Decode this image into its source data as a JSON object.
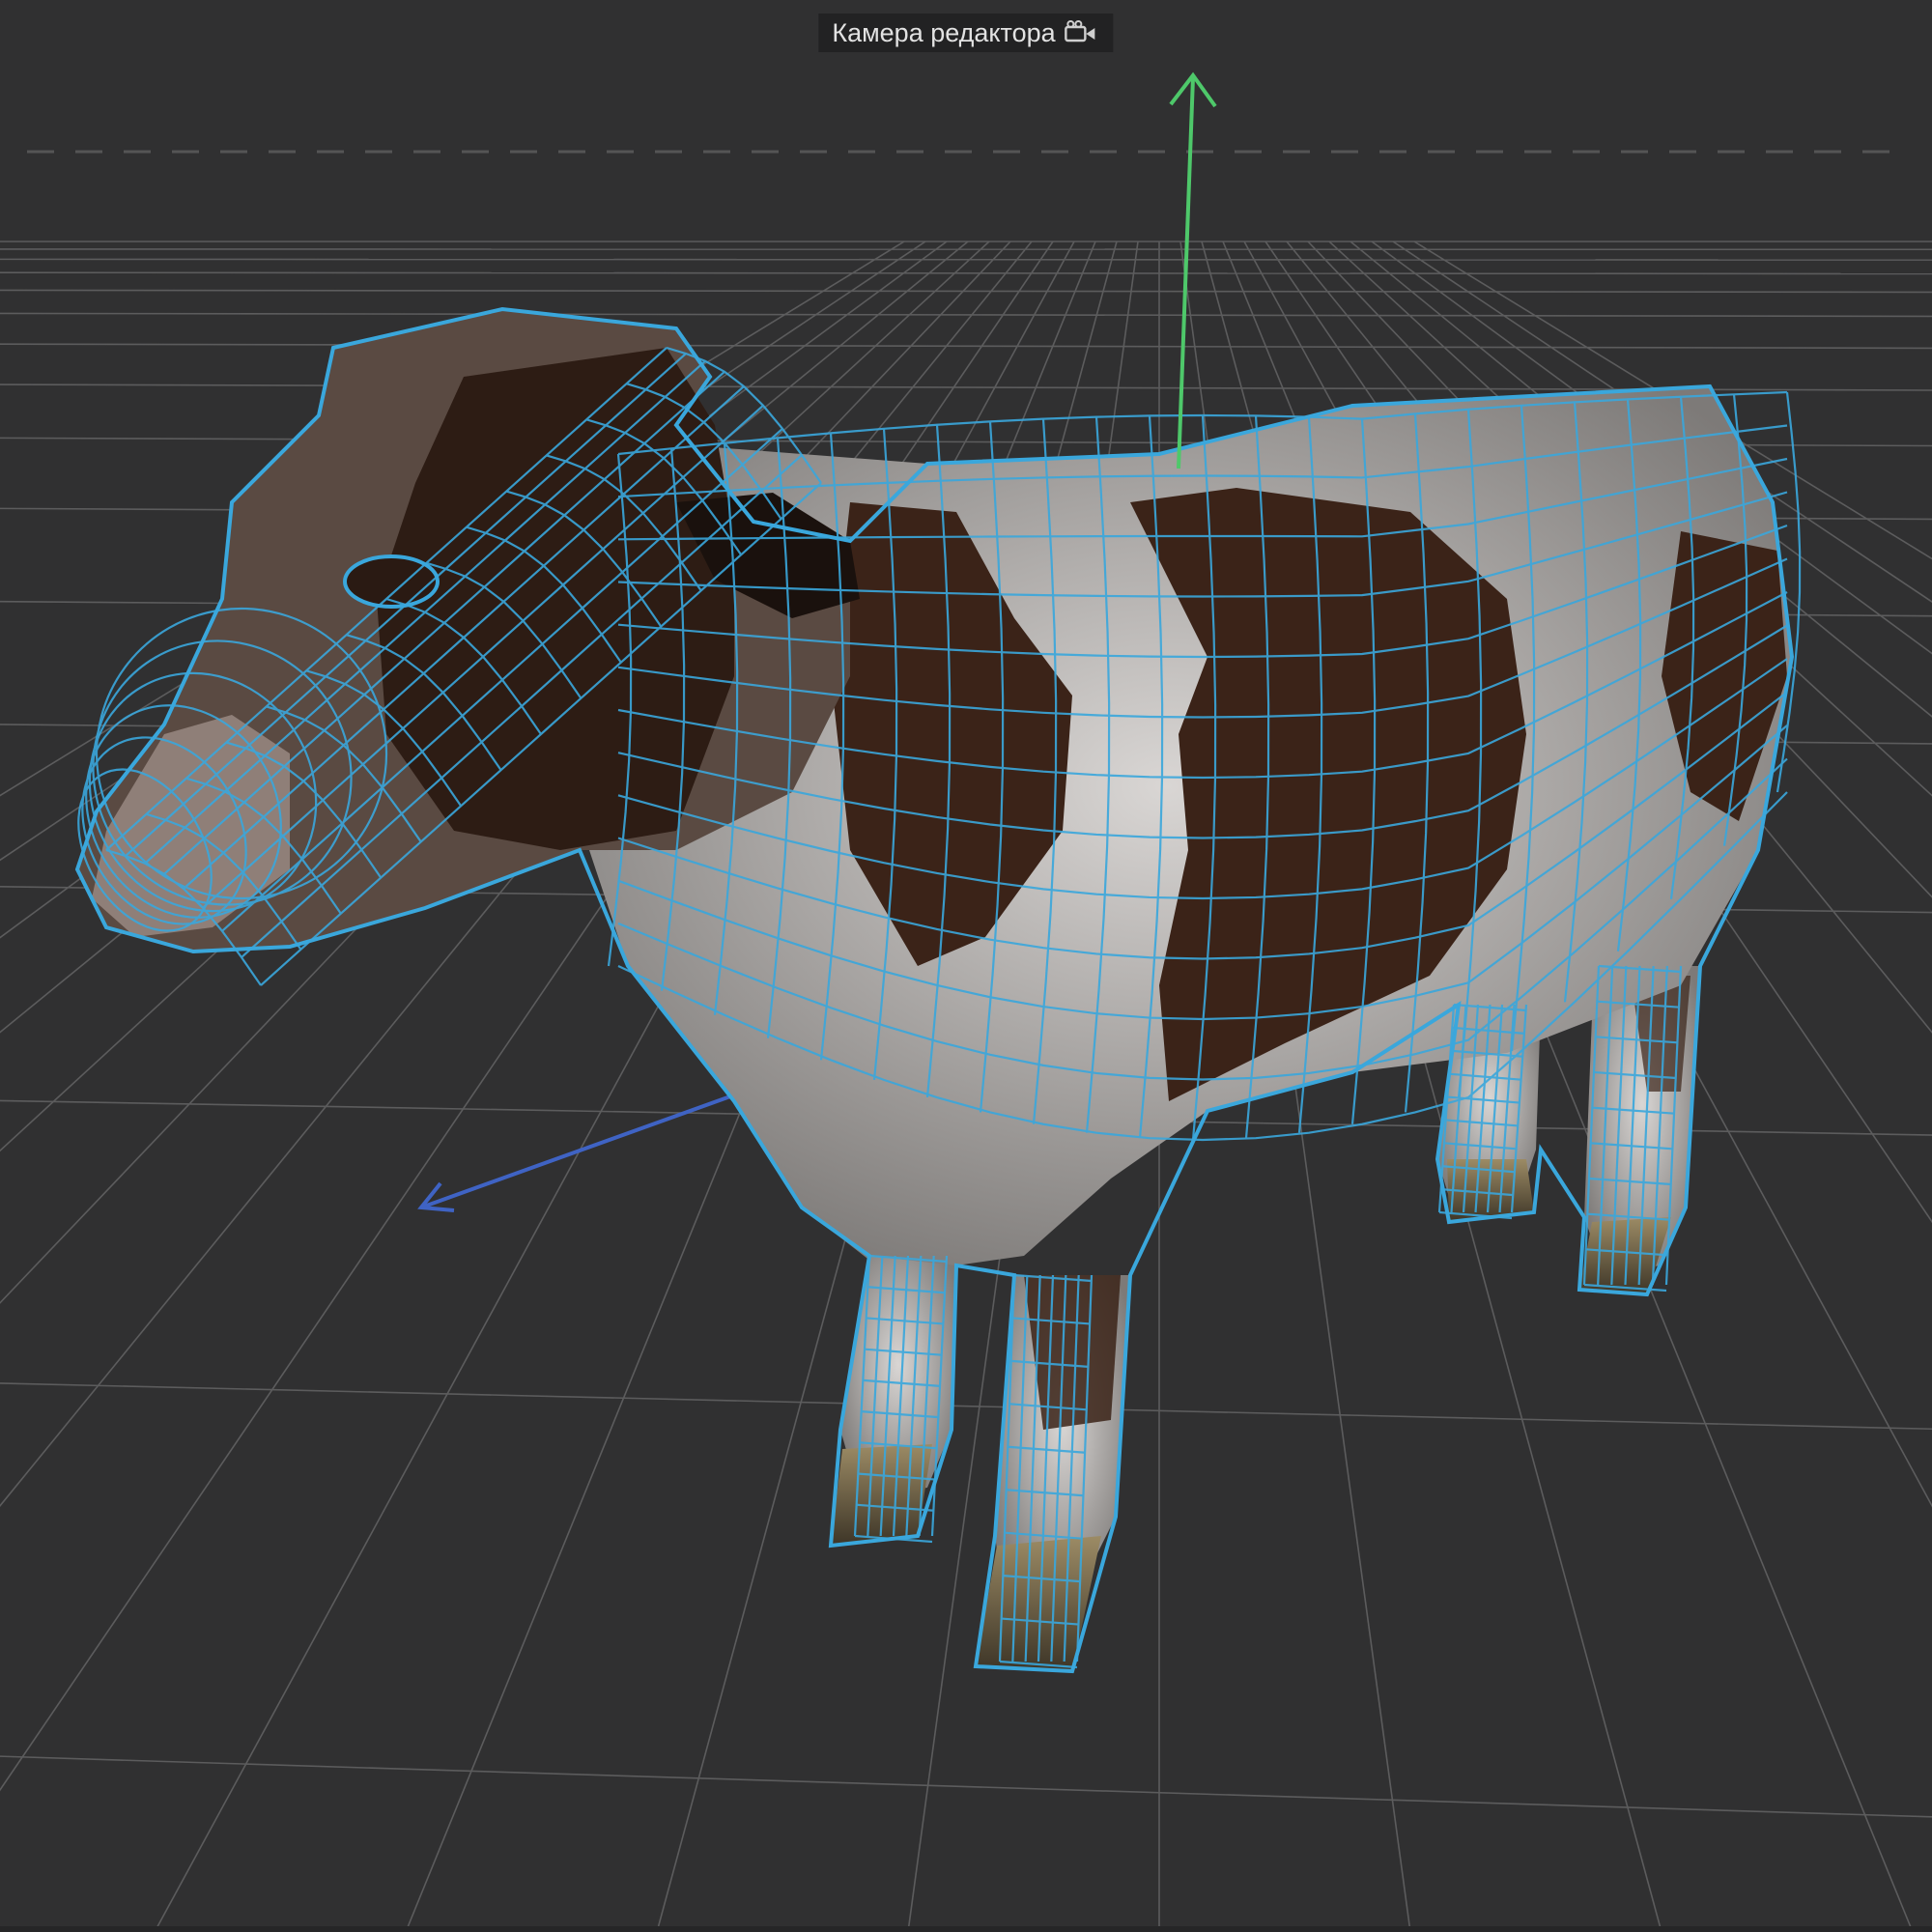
{
  "viewport": {
    "camera_label": "Камера редактора",
    "camera_icon": "camera-icon",
    "gizmo": {
      "y_axis_color": "#4ec86a",
      "z_axis_color": "#3f63c4",
      "x_axis_color": "#d44a4a"
    },
    "wireframe_color": "#3aa7dc",
    "background_color": "#303031",
    "grid_color": "#7a7a7a",
    "model": "cow-mesh",
    "hide_x_axis": true
  }
}
